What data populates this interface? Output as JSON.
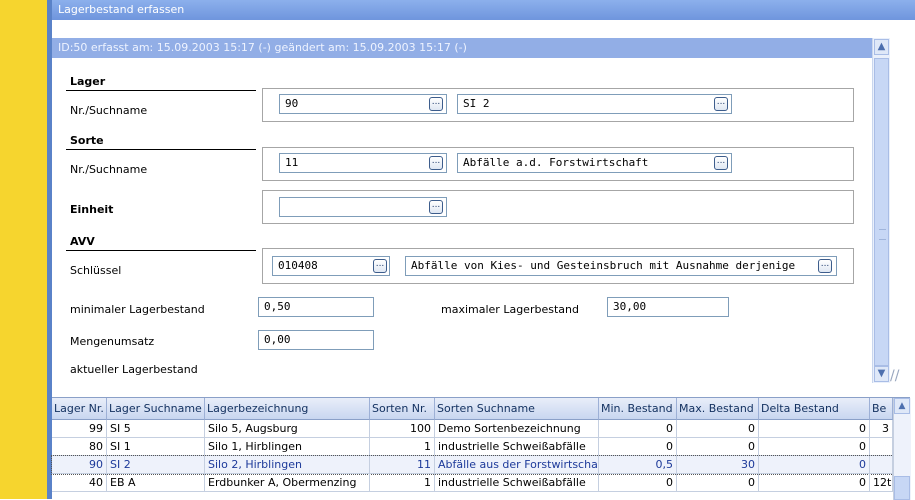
{
  "window": {
    "title": "Lagerbestand erfassen",
    "minimize_glyph": "▫",
    "close_glyph": "✕"
  },
  "info_bar": "ID:50  erfasst am: 15.09.2003 15:17  (-)   geändert am: 15.09.2003 15:17  (-)",
  "lager": {
    "heading": "Lager",
    "label": "Nr./Suchname",
    "nr": "90",
    "name": "SI 2"
  },
  "sorte": {
    "heading": "Sorte",
    "label": "Nr./Suchname",
    "nr": "11",
    "name": "Abfälle a.d. Forstwirtschaft"
  },
  "einheit": {
    "heading": "Einheit",
    "value": ""
  },
  "avv": {
    "heading": "AVV",
    "label": "Schlüssel",
    "key": "010408",
    "description": "Abfälle von Kies- und Gesteinsbruch mit Ausnahme derjenige"
  },
  "bestand": {
    "min_label": "minimaler Lagerbestand",
    "min_value": "0,50",
    "max_label": "maximaler Lagerbestand",
    "max_value": "30,00",
    "umsatz_label": "Mengenumsatz",
    "umsatz_value": "0,00",
    "aktuell_label": "aktueller Lagerbestand"
  },
  "buttons": {
    "dots": "..."
  },
  "scroll": {
    "up": "▲",
    "down": "▼",
    "grip": "//"
  },
  "grid": {
    "columns": [
      "Lager Nr.",
      "Lager Suchname",
      "Lagerbezeichnung",
      "Sorten Nr.",
      "Sorten Suchname",
      "Min. Bestand",
      "Max. Bestand",
      "Delta Bestand",
      "Be"
    ],
    "rows": [
      [
        "99",
        "SI 5",
        "Silo 5, Augsburg",
        "100",
        "Demo Sortenbezeichnung",
        "0",
        "0",
        "0",
        "3"
      ],
      [
        "80",
        "SI 1",
        "Silo 1, Hirblingen",
        "1",
        "industrielle Schweißabfälle",
        "0",
        "0",
        "0",
        ""
      ],
      [
        "90",
        "SI 2",
        "Silo 2, Hirblingen",
        "11",
        "Abfälle aus der Forstwirtschaft",
        "0,5",
        "30",
        "0",
        ""
      ],
      [
        "40",
        "EB A",
        "Erdbunker A, Obermenzing",
        "1",
        "industrielle Schweißabfälle",
        "0",
        "0",
        "0",
        "12t"
      ]
    ]
  }
}
